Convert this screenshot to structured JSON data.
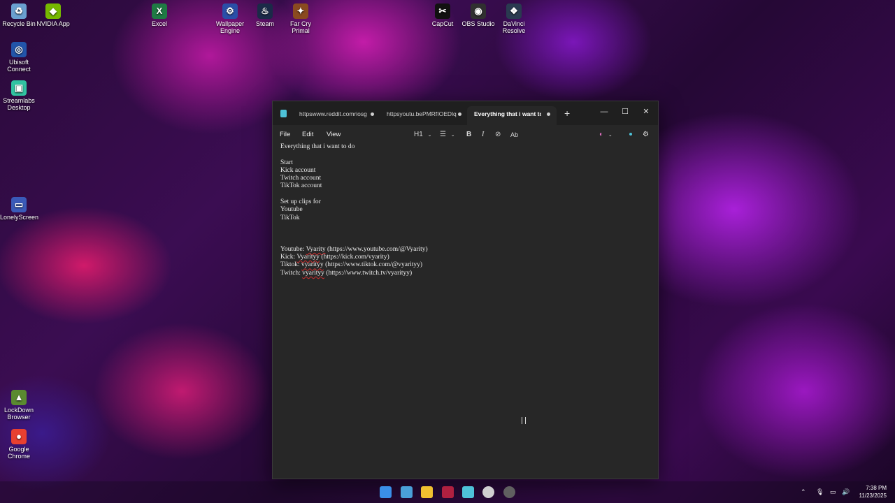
{
  "desktop": {
    "icons": [
      {
        "label": "Recycle Bin",
        "icon": "recycle-bin-icon",
        "glyph": "♻",
        "color": "#6aa0d0"
      },
      {
        "label": "NVIDIA App",
        "icon": "nvidia-icon",
        "glyph": "◆",
        "color": "#76b900"
      },
      {
        "label": "Excel",
        "icon": "excel-icon",
        "glyph": "X",
        "color": "#1f7a44"
      },
      {
        "label": "Wallpaper Engine",
        "icon": "wallpaper-engine-icon",
        "glyph": "⚙",
        "color": "#2a4fa8"
      },
      {
        "label": "Steam",
        "icon": "steam-icon",
        "glyph": "♨",
        "color": "#1b2a48"
      },
      {
        "label": "Far Cry Primal",
        "icon": "far-cry-primal-icon",
        "glyph": "✦",
        "color": "#8a4a20"
      },
      {
        "label": "CapCut",
        "icon": "capcut-icon",
        "glyph": "✂",
        "color": "#111111"
      },
      {
        "label": "OBS Studio",
        "icon": "obs-icon",
        "glyph": "◉",
        "color": "#303030"
      },
      {
        "label": "DaVinci Resolve",
        "icon": "davinci-resolve-icon",
        "glyph": "❖",
        "color": "#2a3a50"
      },
      {
        "label": "Ubisoft Connect",
        "icon": "ubisoft-icon",
        "glyph": "◎",
        "color": "#2255aa"
      },
      {
        "label": "Streamlabs Desktop",
        "icon": "streamlabs-icon",
        "glyph": "▣",
        "color": "#31c3a2"
      },
      {
        "label": "LonelyScreen",
        "icon": "lonelyscreen-icon",
        "glyph": "▭",
        "color": "#3a5ab8"
      },
      {
        "label": "LockDown Browser",
        "icon": "lockdown-browser-icon",
        "glyph": "▲",
        "color": "#5a8a30"
      },
      {
        "label": "Google Chrome",
        "icon": "chrome-icon",
        "glyph": "●",
        "color": "#e84030"
      }
    ]
  },
  "window": {
    "tabs": [
      {
        "label": "httpswww.reddit.comriosg"
      },
      {
        "label": "httpsyoutu.bePMRfIOEDlq"
      },
      {
        "label": "Everything that i want to d"
      }
    ],
    "new_tab": "+",
    "controls": {
      "minimize": "—",
      "maximize": "☐",
      "close": "✕"
    },
    "menu": {
      "file": "File",
      "edit": "Edit",
      "view": "View"
    },
    "toolbar": {
      "heading": "H1",
      "list": "☰",
      "bold": "B",
      "italic": "I",
      "link": "⊘",
      "spell": "Ab",
      "copilot": "◐",
      "settings": "⚙"
    },
    "document": {
      "title": "Everything that i want to do",
      "start": "Start",
      "kick_account": "Kick account",
      "twitch_account": "Twitch account",
      "tiktok_account": "TikTok account",
      "setup_clips": "Set up clips for",
      "youtube": "Youtube",
      "tiktok": "TikTok",
      "link_youtube_prefix": "Youtube: ",
      "link_youtube_name": "Vyarity",
      "link_youtube_url": " (https://www.youtube.com/@Vyarity)",
      "link_kick_prefix": "Kick: ",
      "link_kick_name": "Vyarityy",
      "link_kick_url": " (https://kick.com/vyarity)",
      "link_tiktok_prefix": "Tiktok: ",
      "link_tiktok_name": "vyarityy",
      "link_tiktok_url": " (https://www.tiktok.com/@vyarityy)",
      "link_twitch_prefix": "Twitch: ",
      "link_twitch_name": "vyarityy",
      "link_twitch_url": " (https://www.twitch.tv/vyarityy)"
    }
  },
  "taskbar": {
    "apps": [
      {
        "name": "start-button",
        "color": "#3a8fe8"
      },
      {
        "name": "widgets-icon",
        "color": "#4aa0d8"
      },
      {
        "name": "file-explorer-icon",
        "color": "#f0c030"
      },
      {
        "name": "task-view-icon",
        "color": "#b02040"
      },
      {
        "name": "notepad-icon",
        "color": "#4ec2d8"
      },
      {
        "name": "chatgpt-icon",
        "color": "#d0d0d0"
      },
      {
        "name": "obs-taskbar-icon",
        "color": "#606060"
      }
    ],
    "tray": {
      "chevron": "⌃",
      "mic": "🎙",
      "network": "▭",
      "volume": "🔊"
    },
    "time": "7:38 PM",
    "date": "11/23/2025"
  }
}
